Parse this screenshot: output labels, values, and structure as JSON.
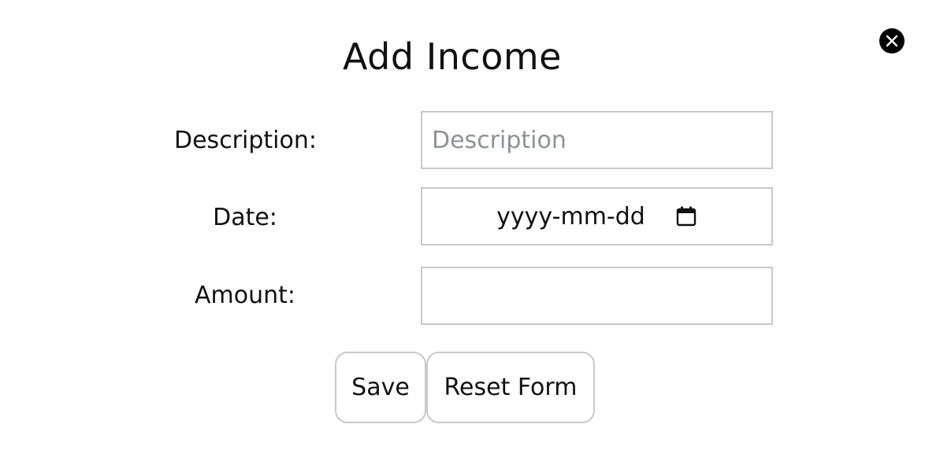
{
  "modal": {
    "title": "Add Income",
    "close_icon": "close-icon"
  },
  "form": {
    "description": {
      "label": "Description:",
      "placeholder": "Description",
      "value": ""
    },
    "date": {
      "label": "Date:",
      "placeholder": "yyyy-mm-dd",
      "icon": "calendar-icon"
    },
    "amount": {
      "label": "Amount:",
      "value": ""
    }
  },
  "actions": {
    "save_label": "Save",
    "reset_label": "Reset Form"
  },
  "colors": {
    "field_border": "#c9c9c9",
    "placeholder": "#8d929a",
    "text": "#111111",
    "close_bg": "#000000"
  }
}
